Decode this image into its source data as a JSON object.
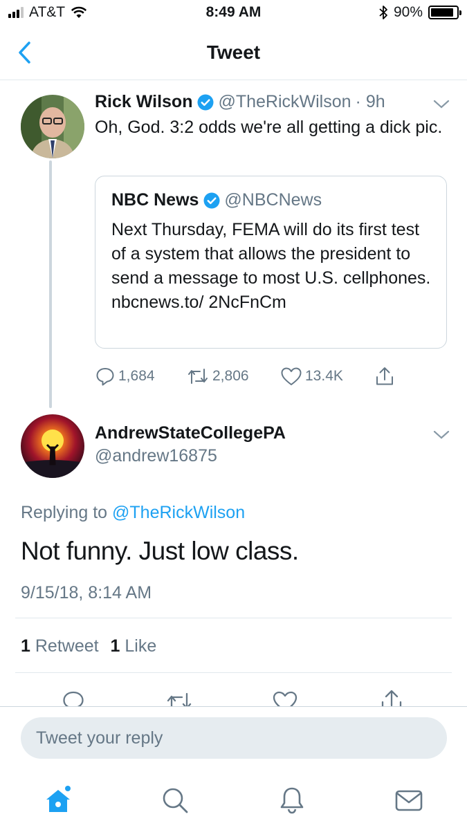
{
  "status_bar": {
    "carrier": "AT&T",
    "time": "8:49 AM",
    "battery_percent_text": "90%",
    "battery_level": 0.9
  },
  "nav": {
    "title": "Tweet"
  },
  "parent_tweet": {
    "name": "Rick Wilson",
    "handle": "@TheRickWilson",
    "time_ago": "· 9h",
    "text": "Oh, God. 3:2 odds we're all getting a dick pic.",
    "quoted": {
      "name": "NBC News",
      "handle": "@NBCNews",
      "text": "Next Thursday, FEMA will do its first test of a system that allows the president to send a message to most U.S. cellphones. nbcnews.to/ 2NcFnCm"
    },
    "replies": "1,684",
    "retweets": "2,806",
    "likes": "13.4K"
  },
  "main_tweet": {
    "name": "AndrewStateCollegePA",
    "handle": "@andrew16875",
    "replying_prefix": "Replying to",
    "replying_to": "@TheRickWilson",
    "text": "Not funny. Just low class.",
    "timestamp": "9/15/18, 8:14 AM",
    "retweet_count": "1",
    "retweet_label": "Retweet",
    "like_count": "1",
    "like_label": "Like"
  },
  "reply_box": {
    "placeholder": "Tweet your reply"
  },
  "tab_bar": {
    "items": [
      "home-icon",
      "search-icon",
      "notifications-icon",
      "messages-icon"
    ]
  },
  "colors": {
    "accent": "#1da1f2",
    "secondary_text": "#657786",
    "border": "#e1e8ed"
  }
}
